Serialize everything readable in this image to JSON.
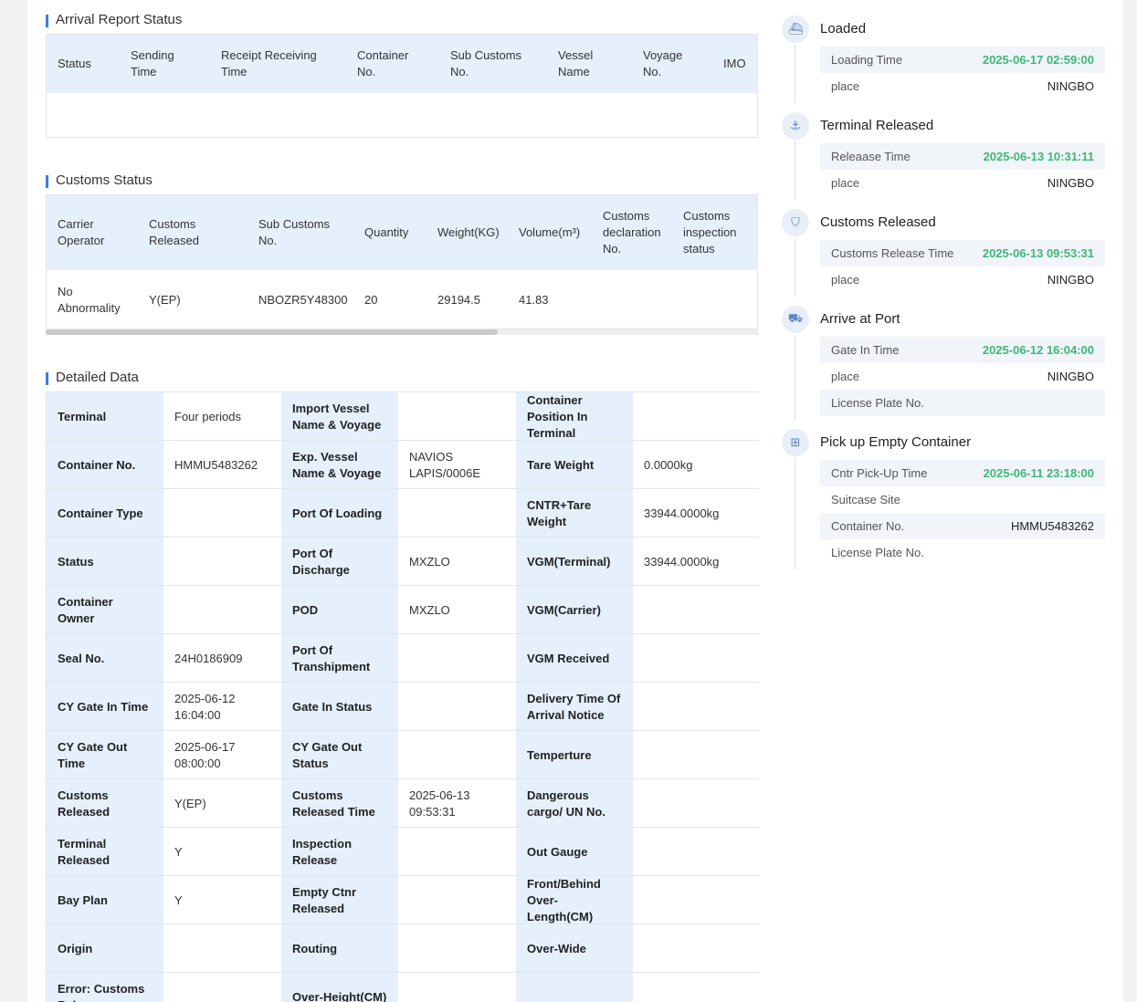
{
  "arrival": {
    "title": "Arrival Report Status",
    "headers": [
      "Status",
      "Sending\nTime",
      "Receipt Receiving\nTime",
      "Container\nNo.",
      "Sub Customs\nNo.",
      "Vessel\nName",
      "Voyage\nNo.",
      "IMO"
    ]
  },
  "customs": {
    "title": "Customs Status",
    "headers": [
      "Carrier\nOperator",
      "Customs\nReleased",
      "Sub Customs\nNo.",
      "Quantity",
      "Weight(KG)",
      "Volume(m³)",
      "Customs\ndeclaration\nNo.",
      "Customs\ninspection\nstatus"
    ],
    "row": [
      "No\nAbnormality",
      "Y(EP)",
      "NBOZR5Y48300",
      "20",
      "29194.5",
      "41.83",
      "",
      ""
    ]
  },
  "detailed": {
    "title": "Detailed Data",
    "rows": [
      [
        "Terminal",
        "Four periods",
        "Import Vessel\nName & Voyage",
        "",
        "Container\nPosition In\nTerminal",
        ""
      ],
      [
        "Container No.",
        "HMMU5483262",
        "Exp. Vessel\nName & Voyage",
        "NAVIOS\nLAPIS/0006E",
        "Tare Weight",
        "0.0000kg"
      ],
      [
        "Container Type",
        "",
        "Port Of Loading",
        "",
        "CNTR+Tare\nWeight",
        "33944.0000kg"
      ],
      [
        "Status",
        "",
        "Port Of\nDischarge",
        "MXZLO",
        "VGM(Terminal)",
        "33944.0000kg"
      ],
      [
        "Container Owner",
        "",
        "POD",
        "MXZLO",
        "VGM(Carrier)",
        ""
      ],
      [
        "Seal No.",
        "24H0186909",
        "Port Of\nTranshipment",
        "",
        "VGM Received",
        ""
      ],
      [
        "CY Gate In Time",
        "2025-06-12\n16:04:00",
        "Gate In Status",
        "",
        "Delivery Time Of\nArrival Notice",
        ""
      ],
      [
        "CY Gate Out\nTime",
        "2025-06-17\n08:00:00",
        "CY Gate Out\nStatus",
        "",
        "Temperture",
        ""
      ],
      [
        "Customs\nReleased",
        "Y(EP)",
        "Customs\nReleased Time",
        "2025-06-13\n09:53:31",
        "Dangerous\ncargo/ UN No.",
        ""
      ],
      [
        "Terminal\nReleased",
        "Y",
        "Inspection\nRelease",
        "",
        "Out Gauge",
        ""
      ],
      [
        "Bay Plan",
        "Y",
        "Empty Ctnr\nReleased",
        "",
        "Front/Behind\nOver-\nLength(CM)",
        ""
      ],
      [
        "Origin",
        "",
        "Routing",
        "",
        "Over-Wide",
        ""
      ],
      [
        "Error: Customs\nRel...",
        "",
        "Over-Height(CM)",
        "",
        "",
        ""
      ]
    ]
  },
  "timeline": [
    {
      "title": "Loaded",
      "icon": "ship-loading-icon",
      "glyph": "⛴",
      "rows": [
        {
          "k": "Loading Time",
          "v": "2025-06-17 02:59:00",
          "green": true
        },
        {
          "k": "place",
          "v": "NINGBO",
          "green": false
        }
      ]
    },
    {
      "title": "Terminal Released",
      "icon": "anchor-icon",
      "glyph": "⚓",
      "rows": [
        {
          "k": "Releaase Time",
          "v": "2025-06-13 10:31:11",
          "green": true
        },
        {
          "k": "place",
          "v": "NINGBO",
          "green": false
        }
      ]
    },
    {
      "title": "Customs Released",
      "icon": "shield-icon",
      "glyph": "⛉",
      "rows": [
        {
          "k": "Customs Release Time",
          "v": "2025-06-13 09:53:31",
          "green": true
        },
        {
          "k": "place",
          "v": "NINGBO",
          "green": false
        }
      ]
    },
    {
      "title": "Arrive at Port",
      "icon": "truck-icon",
      "glyph": "⛟",
      "rows": [
        {
          "k": "Gate In Time",
          "v": "2025-06-12 16:04:00",
          "green": true
        },
        {
          "k": "place",
          "v": "NINGBO",
          "green": false
        },
        {
          "k": "License Plate No.",
          "v": "",
          "green": false
        }
      ]
    },
    {
      "title": "Pick up Empty Container",
      "icon": "container-icon",
      "glyph": "⊞",
      "rows": [
        {
          "k": "Cntr Pick-Up Time",
          "v": "2025-06-11 23:18:00",
          "green": true
        },
        {
          "k": "Suitcase Site",
          "v": "",
          "green": false
        },
        {
          "k": "Container No.",
          "v": "HMMU5483262",
          "green": false
        },
        {
          "k": "License Plate No.",
          "v": "",
          "green": false
        }
      ]
    }
  ],
  "colors": {
    "accent": "#3b7bea",
    "green": "#3cb878",
    "header_bg": "#e6f0fc"
  }
}
